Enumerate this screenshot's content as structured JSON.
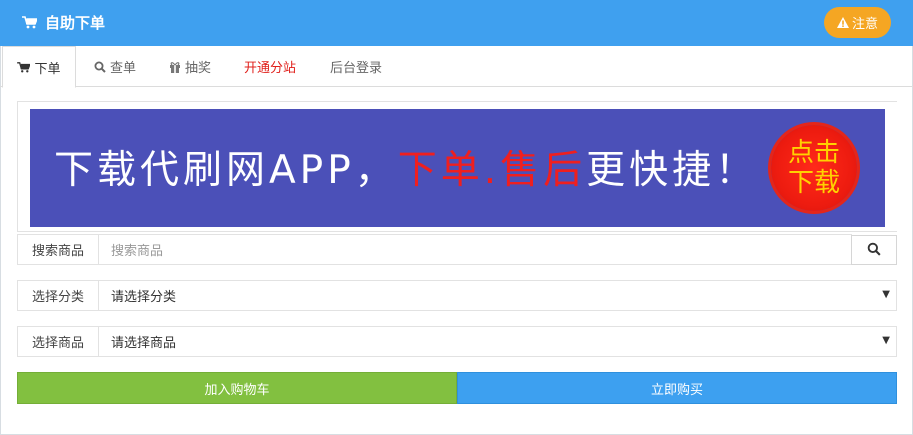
{
  "header": {
    "title": "自助下单",
    "notice_label": "注意",
    "bg_color": "#3fa0ef",
    "notice_color": "#f5a623"
  },
  "tabs": [
    {
      "label": "下单",
      "icon": "cart-icon",
      "active": true
    },
    {
      "label": "查单",
      "icon": "search-icon"
    },
    {
      "label": "抽奖",
      "icon": "gift-icon"
    },
    {
      "label": "开通分站",
      "color": "#e0201b"
    },
    {
      "label": "后台登录"
    }
  ],
  "banner": {
    "text_before": "下载代刷网APP，",
    "text_highlight": "下单.售后",
    "text_after": "更快捷！",
    "badge_line1": "点击",
    "badge_line2": "下载",
    "bg_color": "#4b50b8",
    "highlight_color": "#ef1f1f"
  },
  "form": {
    "search": {
      "label": "搜索商品",
      "placeholder": "搜索商品"
    },
    "category": {
      "label": "选择分类",
      "value": "请选择分类"
    },
    "product": {
      "label": "选择商品",
      "value": "请选择商品"
    }
  },
  "actions": {
    "add_to_cart": "加入购物车",
    "buy_now": "立即购买",
    "cart_color": "#82c040",
    "buy_color": "#3da0f0"
  }
}
